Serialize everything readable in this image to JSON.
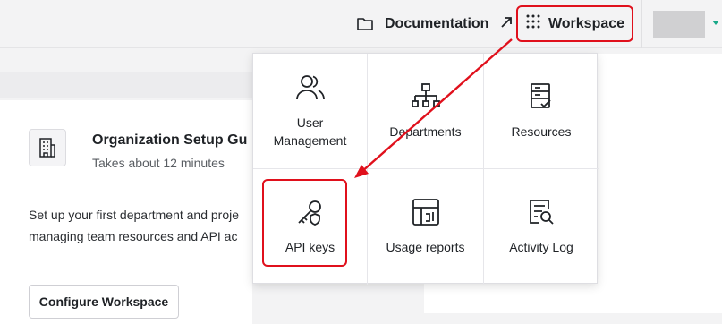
{
  "topbar": {
    "documentation_label": "Documentation",
    "workspace_label": "Workspace"
  },
  "card": {
    "title": "Organization Setup Gu",
    "subtitle": "Takes about 12 minutes",
    "description_line1": "Set up your first department and proje",
    "description_line2": "managing team resources and API ac",
    "button_label": "Configure Workspace"
  },
  "menu": {
    "items": [
      {
        "label_line1": "User",
        "label_line2": "Management",
        "icon": "users-icon"
      },
      {
        "label": "Departments",
        "icon": "org-chart-icon"
      },
      {
        "label": "Resources",
        "icon": "server-list-icon"
      },
      {
        "label": "API keys",
        "icon": "key-shield-icon"
      },
      {
        "label": "Usage reports",
        "icon": "usage-report-icon"
      },
      {
        "label": "Activity Log",
        "icon": "log-search-icon"
      }
    ]
  },
  "colors": {
    "highlight": "#e0101c",
    "avatar_caret": "#18a888"
  }
}
